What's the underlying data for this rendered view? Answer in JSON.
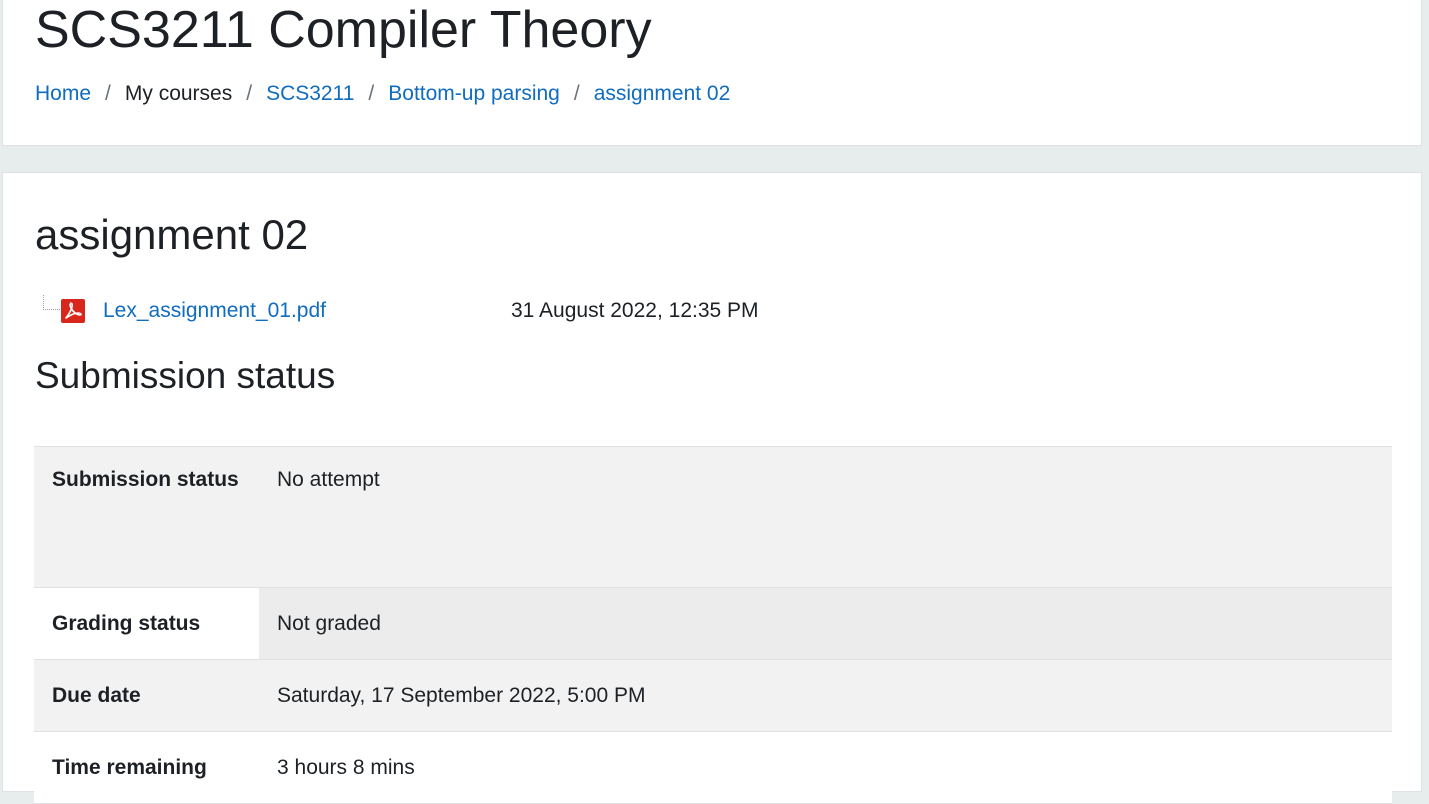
{
  "header": {
    "course_title": "SCS3211 Compiler Theory",
    "breadcrumb": [
      {
        "label": "Home",
        "link": true
      },
      {
        "label": "My courses",
        "link": false
      },
      {
        "label": "SCS3211",
        "link": true
      },
      {
        "label": "Bottom-up parsing",
        "link": true
      },
      {
        "label": "assignment 02",
        "link": true
      }
    ],
    "separator": "/"
  },
  "main": {
    "heading": "assignment 02",
    "attachment": {
      "icon": "pdf-icon",
      "file_name": "Lex_assignment_01.pdf",
      "date": "31 August 2022, 12:35 PM"
    },
    "section_heading": "Submission status",
    "status_rows": [
      {
        "label": "Submission status",
        "value": "No attempt"
      },
      {
        "label": "Grading status",
        "value": "Not graded"
      },
      {
        "label": "Due date",
        "value": "Saturday, 17 September 2022, 5:00 PM"
      },
      {
        "label": "Time remaining",
        "value": "3 hours 8 mins"
      }
    ]
  },
  "colors": {
    "link": "#0f6cbf",
    "text": "#1d2125",
    "page_background": "#e7ecec",
    "row_shade": "#f2f2f2"
  }
}
